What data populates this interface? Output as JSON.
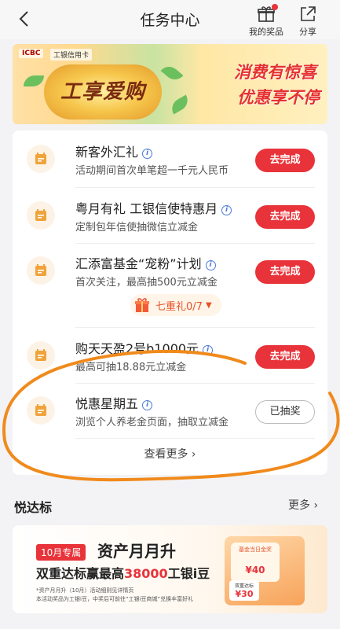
{
  "header": {
    "title": "任务中心",
    "my_prizes": "我的奖品",
    "share": "分享"
  },
  "banner": {
    "bank_name": "ICBC",
    "card_name": "工银信用卡",
    "promo": "工享爱购",
    "slogan1": "消费有惊喜",
    "slogan2": "优惠享不停"
  },
  "tasks": [
    {
      "name": "新客外汇礼",
      "desc": "活动期间首次单笔超一千元人民币",
      "button": "去完成"
    },
    {
      "name": "粤月有礼 工银信使特惠月",
      "desc": "定制包年信使抽微信立减金",
      "button": "去完成"
    },
    {
      "name": "汇添富基金“宠粉”计划",
      "desc": "首次关注，最高抽500元立减金",
      "button": "去完成"
    },
    {
      "name": "购天天盈2号b1000元",
      "desc": "最高可抽18.88元立减金",
      "button": "去完成"
    },
    {
      "name": "悦惠星期五",
      "desc": "浏览个人养老金页面，抽取立减金",
      "button": "已抽奖"
    }
  ],
  "gift": {
    "label": "七重礼0/7"
  },
  "more_label": "查看更多",
  "section": {
    "title": "悦达标",
    "more": "更多"
  },
  "ad": {
    "tag": "10月专属",
    "headline": "资产月月升",
    "line2_prefix": "双重达标赢最高",
    "line2_highlight": "38000",
    "line2_suffix": "工银i豆",
    "fine1": "*资产月月升（10月）活动细则见详情页",
    "fine2": "本活动奖品为工银i豆，中奖后可前往“工银i豆商城”兑换丰富好礼",
    "card1_title": "基金当日金奖",
    "card1_value": "¥40",
    "card2_title": "双重达标",
    "card2_value": "¥30"
  },
  "colors": {
    "accent": "#e8333a",
    "icon": "#f0a33a",
    "scribble": "#f08a1c"
  }
}
